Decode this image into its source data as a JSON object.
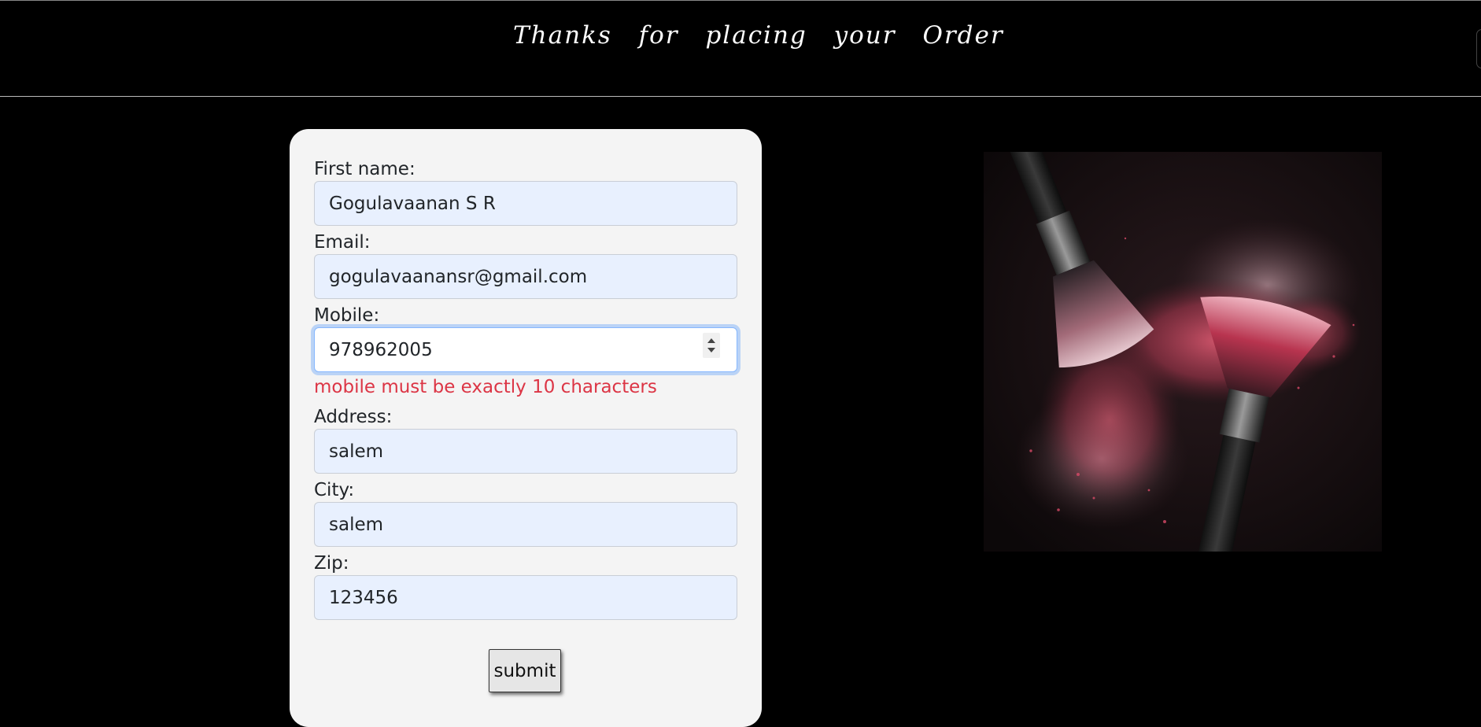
{
  "header": {
    "title": "Thanks for placing your Order"
  },
  "form": {
    "fields": [
      {
        "label": "First name:",
        "value": "Gogulavaanan S R"
      },
      {
        "label": "Email:",
        "value": "gogulavaanansr@gmail.com"
      },
      {
        "label": "Mobile:",
        "value": "978962005"
      },
      {
        "label": "Address:",
        "value": "salem"
      },
      {
        "label": "City:",
        "value": "salem"
      },
      {
        "label": "Zip:",
        "value": "123456"
      }
    ],
    "mobile_error": "mobile must be exactly 10 characters",
    "submit_label": "submit"
  },
  "image": {
    "subject": "makeup-brushes-with-pink-powder"
  },
  "colors": {
    "background": "#000000",
    "card": "#f4f4f4",
    "input_autofill": "#e8f0fe",
    "focus_ring": "#86b7fe",
    "error": "#dc3545",
    "powder": "#c0405a"
  }
}
